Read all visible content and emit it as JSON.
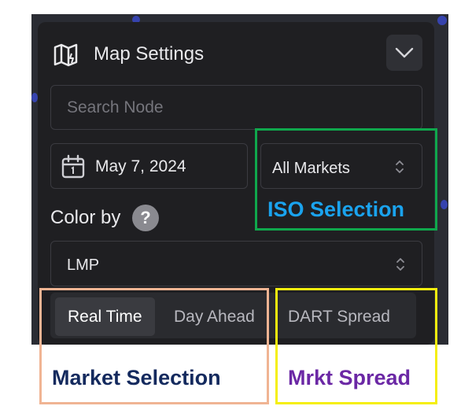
{
  "header": {
    "title": "Map Settings",
    "icon": "map-icon",
    "collapse_icon": "chevron-down-icon"
  },
  "search": {
    "placeholder": "Search Node",
    "value": ""
  },
  "date": {
    "value": "May 7, 2024",
    "icon": "calendar-icon"
  },
  "markets": {
    "selected": "All Markets",
    "icon": "up-down-chevron-icon"
  },
  "color_by": {
    "label": "Color by",
    "help_glyph": "?",
    "selected": "LMP"
  },
  "market_toggle": {
    "options": [
      {
        "label": "Real Time",
        "active": true
      },
      {
        "label": "Day Ahead",
        "active": false
      },
      {
        "label": "DART Spread",
        "active": false
      }
    ]
  },
  "annotations": {
    "iso": {
      "label": "ISO Selection",
      "color": "#0fa74c"
    },
    "market": {
      "label": "Market Selection",
      "color": "#f0b493"
    },
    "spread": {
      "label": "Mrkt Spread",
      "color": "#f5ef0e"
    }
  },
  "colors": {
    "panel_bg": "#1f1f22",
    "text": "#e9e9ec",
    "map_bg": "#2a2c33"
  }
}
